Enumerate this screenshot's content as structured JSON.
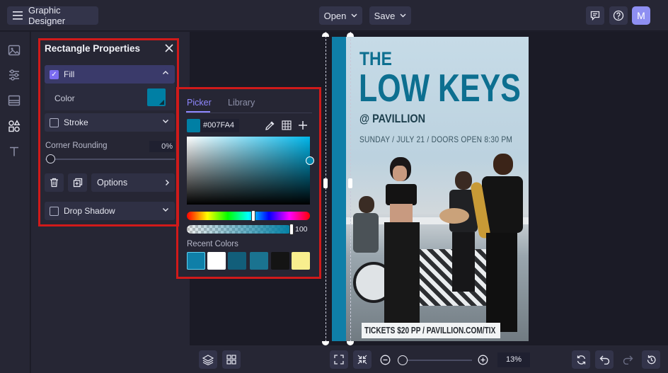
{
  "app": {
    "title": "Graphic Designer",
    "open_label": "Open",
    "save_label": "Save",
    "avatar": "M"
  },
  "panel": {
    "title": "Rectangle Properties",
    "fill_label": "Fill",
    "color_label": "Color",
    "fill_color": "#007FA4",
    "stroke_label": "Stroke",
    "corner_label": "Corner Rounding",
    "corner_value": "0%",
    "options_label": "Options",
    "shadow_label": "Drop Shadow"
  },
  "picker": {
    "tab_picker": "Picker",
    "tab_library": "Library",
    "hex": "#007FA4",
    "opacity": "100",
    "recent_label": "Recent Colors",
    "recent_colors": [
      "#0f7fa8",
      "#ffffff",
      "#125e7a",
      "#1a7390",
      "#141414",
      "#f8ee8e"
    ]
  },
  "poster": {
    "line1": "THE",
    "line2": "LOW KEYS",
    "line3": "@ PAVILLION",
    "line4": "SUNDAY / JULY 21 / DOORS OPEN 8:30 PM",
    "footer": "TICKETS $20 PP / PAVILLION.COM/TIX"
  },
  "zoom": {
    "value": "13%",
    "level": 0.13
  },
  "colors": {
    "accent": "#7b6cf0",
    "highlight": "#d01a1a",
    "brand": "#007FA4"
  }
}
